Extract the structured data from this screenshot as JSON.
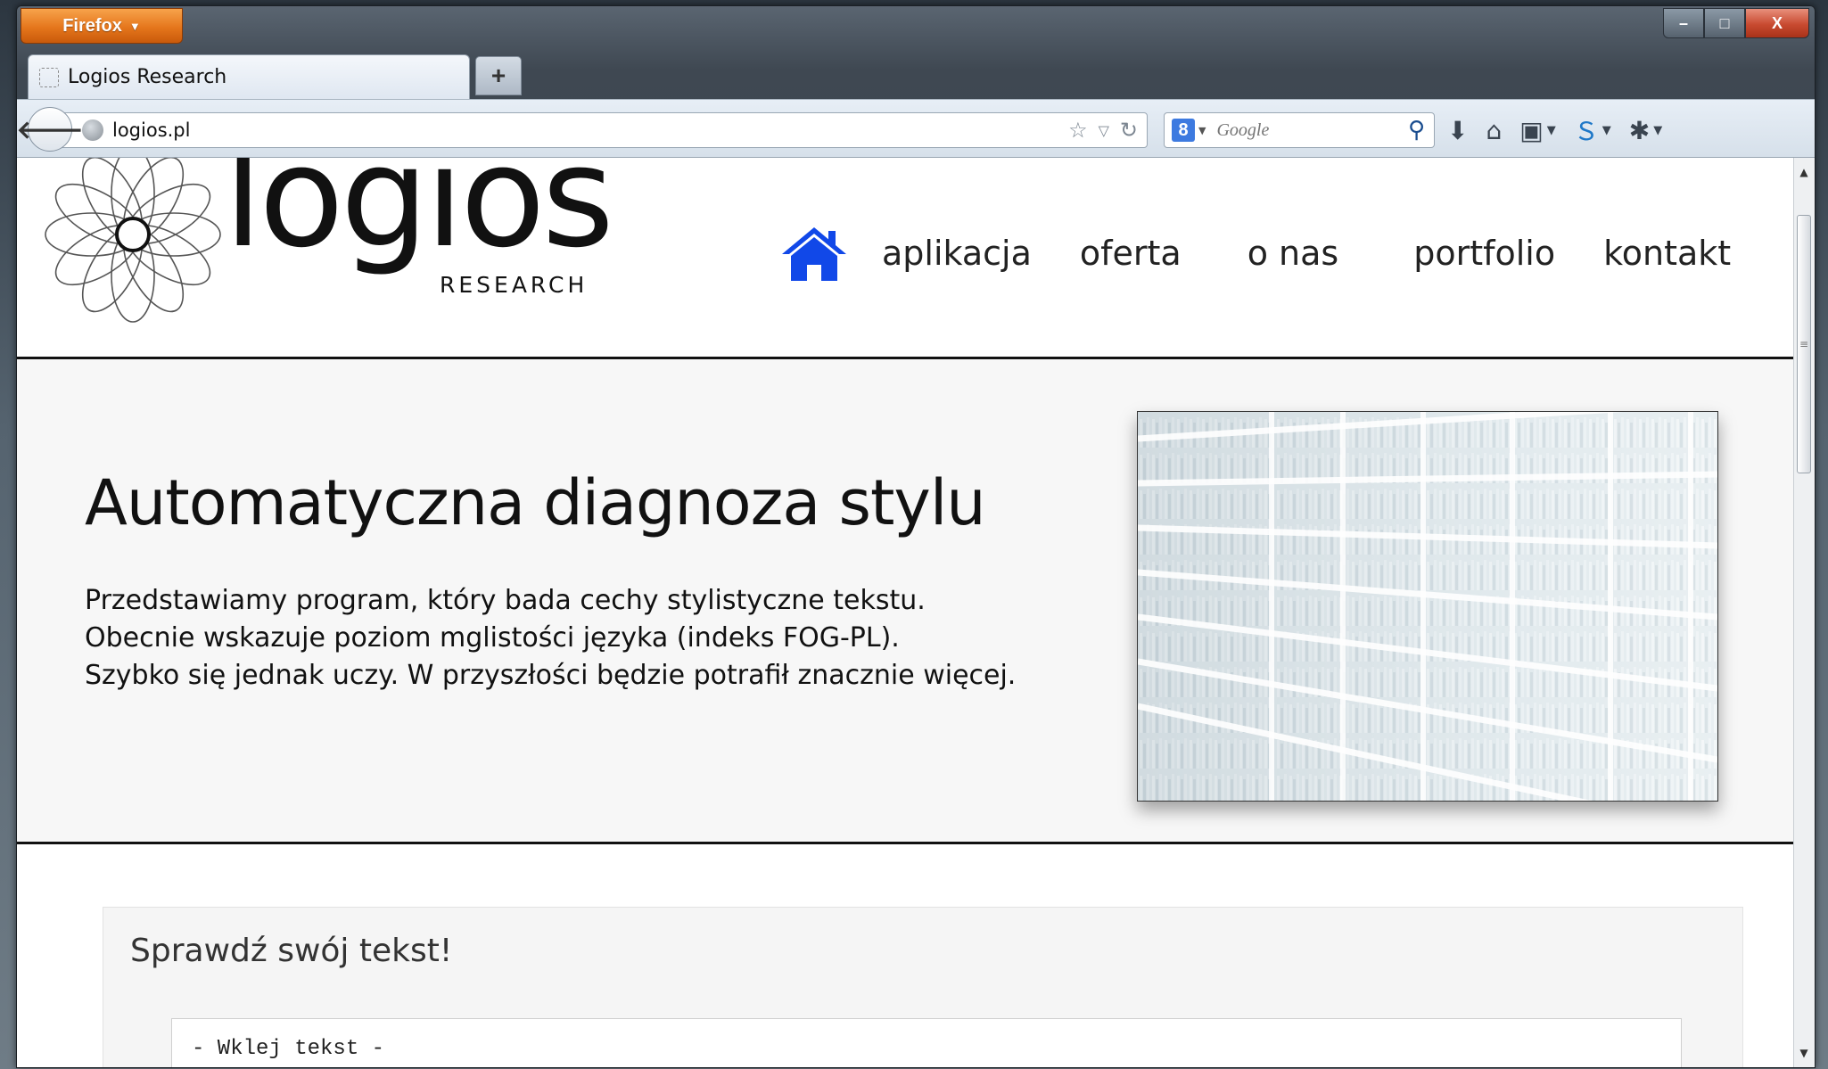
{
  "browser": {
    "app_button_label": "Firefox",
    "tab_title": "Logios Research",
    "new_tab_label": "+",
    "url": "logios.pl",
    "search_placeholder": "Google",
    "search_engine_label": "8"
  },
  "site": {
    "logo_word": "logios",
    "logo_sub": "RESEARCH",
    "nav": [
      "aplikacja",
      "oferta",
      "o nas",
      "portfolio",
      "kontakt"
    ],
    "accent_color": "#1148e8"
  },
  "hero": {
    "title": "Automatyczna diagnoza stylu",
    "lines": [
      "Przedstawiamy program, który bada cechy stylistyczne tekstu.",
      "Obecnie wskazuje poziom mglistości języka (indeks FOG-PL).",
      "Szybko się jednak uczy. W przyszłości będzie potrafił znacznie więcej."
    ]
  },
  "checker": {
    "title": "Sprawdź swój tekst!",
    "textarea_value": "- Wklej tekst -"
  }
}
